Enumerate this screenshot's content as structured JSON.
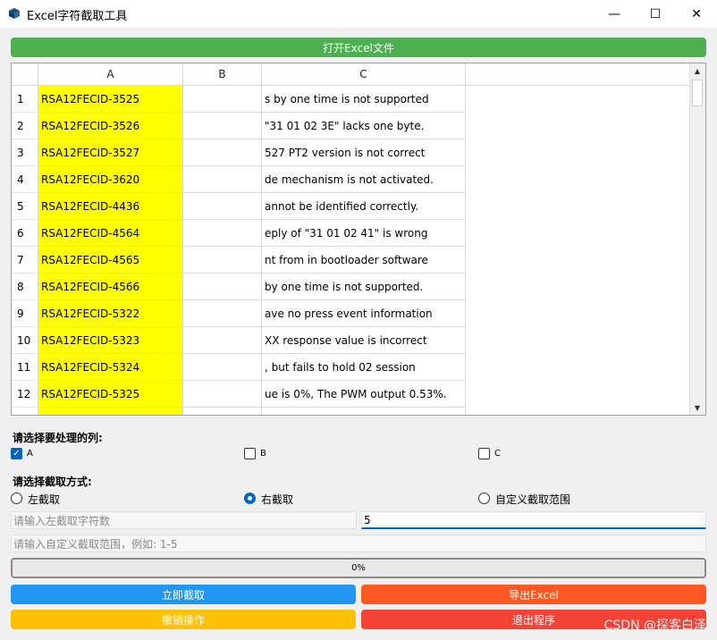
{
  "window": {
    "title": "Excel字符截取工具",
    "minimize": "—",
    "maximize": "☐",
    "close": "✕"
  },
  "open_button": "打开Excel文件",
  "table": {
    "columns": [
      "A",
      "B",
      "C"
    ],
    "rows": [
      {
        "num": "1",
        "a": "RSA12FECID-3525",
        "b": "",
        "c": "s by one time is not supported"
      },
      {
        "num": "2",
        "a": "RSA12FECID-3526",
        "b": "",
        "c": " \"31 01 02 3E\" lacks one byte."
      },
      {
        "num": "3",
        "a": "RSA12FECID-3527",
        "b": "",
        "c": "527 PT2 version is not correct"
      },
      {
        "num": "4",
        "a": "RSA12FECID-3620",
        "b": "",
        "c": "de mechanism is not activated."
      },
      {
        "num": "5",
        "a": "RSA12FECID-4436",
        "b": "",
        "c": "annot be identified correctly."
      },
      {
        "num": "6",
        "a": "RSA12FECID-4564",
        "b": "",
        "c": "eply of \"31 01 02 41\" is wrong"
      },
      {
        "num": "7",
        "a": "RSA12FECID-4565",
        "b": "",
        "c": "nt from in bootloader software"
      },
      {
        "num": "8",
        "a": "RSA12FECID-4566",
        "b": "",
        "c": " by one time is not supported."
      },
      {
        "num": "9",
        "a": "RSA12FECID-5322",
        "b": "",
        "c": "ave no press event information"
      },
      {
        "num": "10",
        "a": "RSA12FECID-5323",
        "b": "",
        "c": "XX response value is incorrect"
      },
      {
        "num": "11",
        "a": "RSA12FECID-5324",
        "b": "",
        "c": ", but fails to hold 02 session"
      },
      {
        "num": "12",
        "a": "RSA12FECID-5325",
        "b": "",
        "c": "ue is 0%, The PWM output 0.53%."
      },
      {
        "num": "",
        "a": "",
        "b": "",
        "c": ""
      }
    ]
  },
  "columns_section": {
    "label": "请选择要处理的列:",
    "options": [
      {
        "label": "A",
        "checked": true
      },
      {
        "label": "B",
        "checked": false
      },
      {
        "label": "C",
        "checked": false
      }
    ]
  },
  "mode_section": {
    "label": "请选择截取方式:",
    "options": [
      {
        "label": "左截取",
        "selected": false
      },
      {
        "label": "右截取",
        "selected": true
      },
      {
        "label": "自定义截取范围",
        "selected": false
      }
    ]
  },
  "inputs": {
    "left_count_placeholder": "请输入左截取字符数",
    "right_count_value": "5",
    "range_placeholder": "请输入自定义截取范围，例如: 1-5"
  },
  "progress": {
    "value": 0,
    "text": "0%"
  },
  "buttons": {
    "cut_now": "立即截取",
    "export": "导出Excel",
    "undo": "撤销操作",
    "exit": "退出程序"
  },
  "colors": {
    "open": "#4caf50",
    "cut_now": "#2196f3",
    "export": "#ff5722",
    "undo": "#ffc107",
    "exit": "#f44336",
    "highlight": "#ffff00",
    "accent": "#0067c0"
  },
  "watermark": "CSDN @探客白泽"
}
